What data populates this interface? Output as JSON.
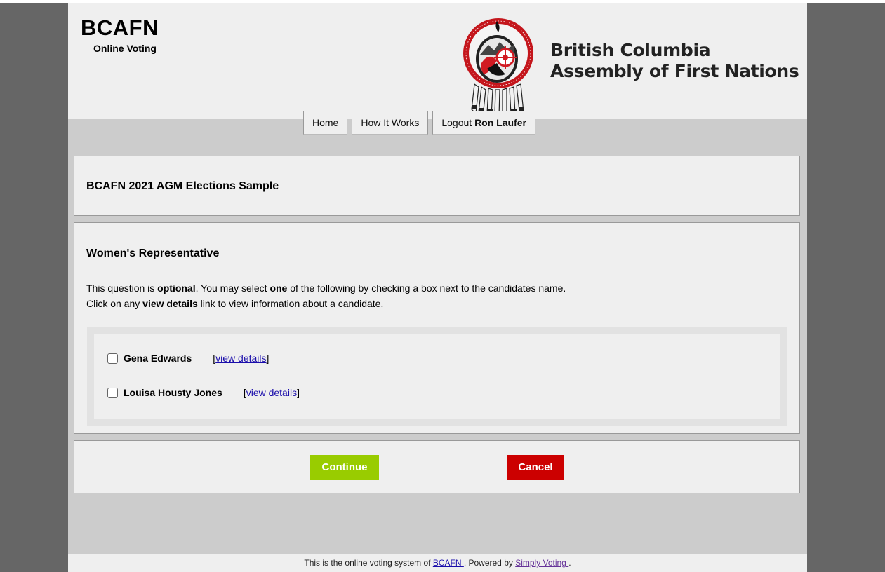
{
  "header": {
    "site_title": "BCAFN",
    "site_subtitle": "Online Voting",
    "org_name_line1": "British Columbia",
    "org_name_line2": "Assembly of First Nations",
    "logo_icon": "assembly-emblem-icon"
  },
  "nav": {
    "home": "Home",
    "how_it_works": "How It Works",
    "logout_prefix": "Logout",
    "logout_user": "Ron Laufer"
  },
  "election": {
    "title": "BCAFN 2021 AGM Elections Sample"
  },
  "question": {
    "title": "Women's Representative",
    "line1_a": "This question is ",
    "line1_b": "optional",
    "line1_c": ". You may select ",
    "line1_d": "one",
    "line1_e": " of the following by checking a box next to the candidates name.",
    "line2_a": "Click on any ",
    "line2_b": "view details",
    "line2_c": " link to view information about a candidate.",
    "candidates": [
      {
        "name": "Gena Edwards",
        "link": "view details",
        "checked": false
      },
      {
        "name": "Louisa Housty Jones",
        "link": "view details",
        "checked": false
      }
    ]
  },
  "actions": {
    "continue": "Continue",
    "cancel": "Cancel"
  },
  "footer": {
    "text_a": "This is the online voting system of ",
    "link1": "BCAFN ",
    "text_b": ". Powered by ",
    "link2": "Simply Voting ",
    "text_c": "."
  },
  "colors": {
    "continue": "#99cc00",
    "cancel": "#cc0000",
    "link": "#1a0dab",
    "visited_link": "#663399"
  }
}
